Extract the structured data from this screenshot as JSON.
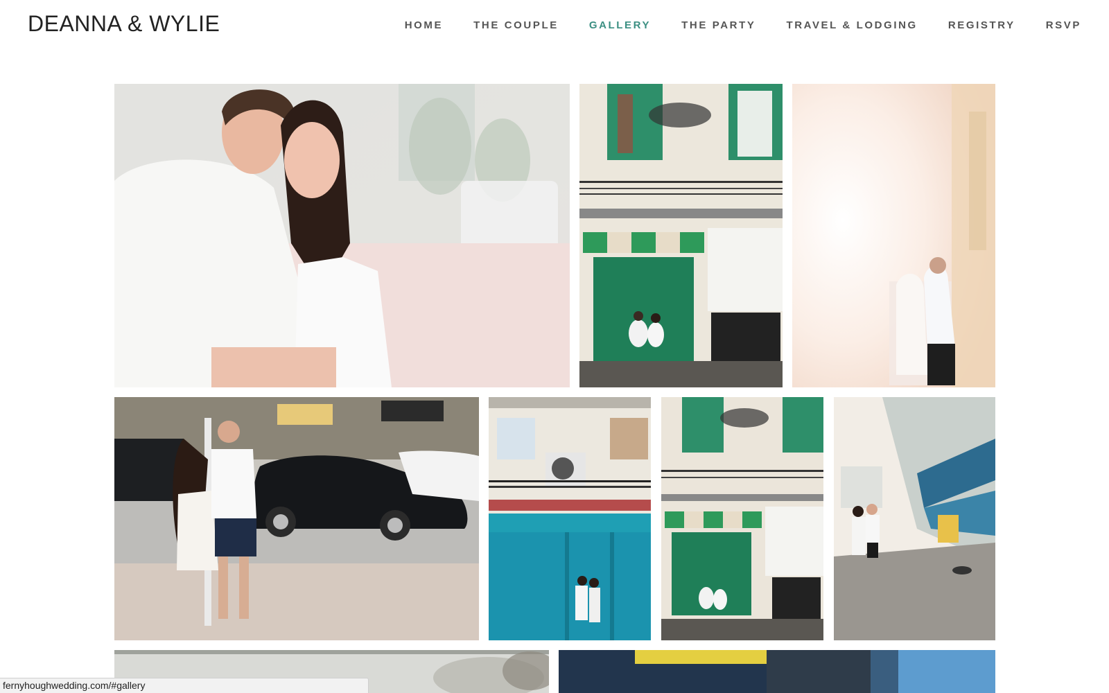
{
  "site": {
    "title": "DEANNA & WYLIE"
  },
  "nav": {
    "items": [
      {
        "label": "HOME"
      },
      {
        "label": "THE COUPLE"
      },
      {
        "label": "GALLERY"
      },
      {
        "label": "THE PARTY"
      },
      {
        "label": "TRAVEL & LODGING"
      },
      {
        "label": "REGISTRY"
      },
      {
        "label": "RSVP"
      }
    ],
    "active": "GALLERY"
  },
  "colors": {
    "accent": "#3b8f82",
    "nav_text": "#555555",
    "title_text": "#222222"
  },
  "status_bar": {
    "url": "fernyhoughwedding.com/#gallery"
  }
}
